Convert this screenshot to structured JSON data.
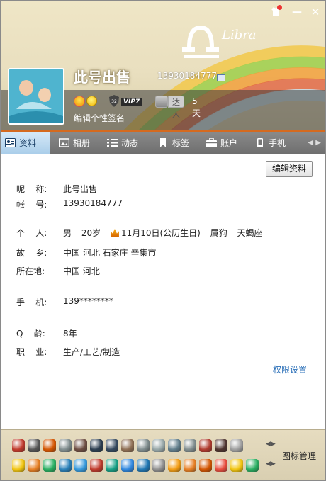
{
  "window": {
    "skin_icon": "tshirt-icon",
    "minimize_label": "—",
    "close_label": "✕"
  },
  "profile": {
    "nickname": "此号出售",
    "qq_number": "13930184777",
    "vip_label": "VIP7",
    "daren_label": "达人",
    "days": "5天",
    "signature_placeholder": "编辑个性签名"
  },
  "tabs": [
    {
      "label": "资料",
      "icon": "profile-card-icon",
      "active": true
    },
    {
      "label": "相册",
      "icon": "photo-album-icon",
      "active": false
    },
    {
      "label": "动态",
      "icon": "feed-list-icon",
      "active": false
    },
    {
      "label": "标签",
      "icon": "bookmark-icon",
      "active": false
    },
    {
      "label": "账户",
      "icon": "wallet-icon",
      "active": false
    },
    {
      "label": "手机",
      "icon": "mobile-phone-icon",
      "active": false
    }
  ],
  "edit_button": "编辑资料",
  "fields": {
    "nickname": {
      "label": "昵    称:",
      "value": "此号出售"
    },
    "account": {
      "label": "帐    号:",
      "value": "13930184777"
    },
    "personal": {
      "label": "个    人:",
      "gender": "男",
      "age": "20岁",
      "birthday": "11月10日(公历生日)",
      "zodiac": "属狗",
      "constellation": "天蝎座"
    },
    "hometown": {
      "label": "故    乡:",
      "value": "中国 河北 石家庄 辛集市"
    },
    "location": {
      "label": "所在地:",
      "value": "中国 河北"
    },
    "mobile": {
      "label": "手    机:",
      "value": "139********"
    },
    "qage": {
      "label": "Q    龄:",
      "value": "8年"
    },
    "job": {
      "label": "职    业:",
      "value": "生产/工艺/制造"
    }
  },
  "permission_link": "权限设置",
  "icon_manage": "图标管理",
  "colors": {
    "tab_bar": "#7a7a7a",
    "tab_active": "#b9d8f0",
    "accent_line": "#d56a1f",
    "link": "#2a6fb8",
    "bottom_bar": "#ded4b6"
  }
}
